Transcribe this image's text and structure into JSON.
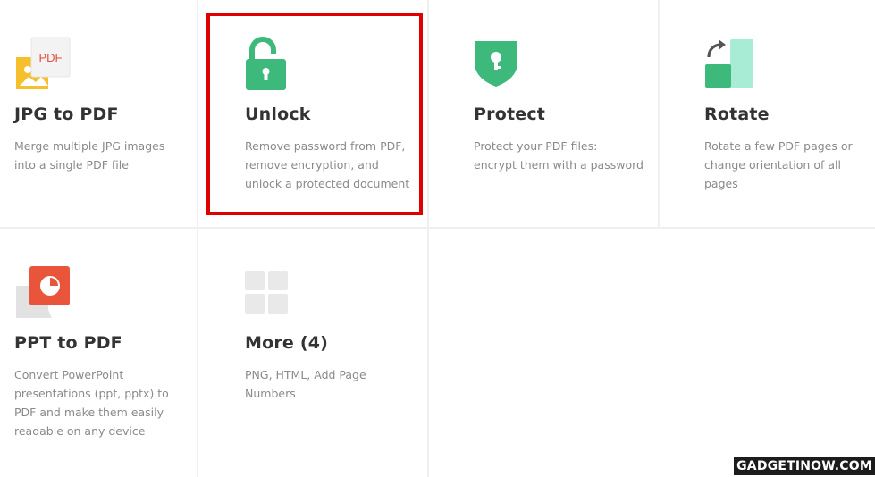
{
  "tools": [
    {
      "title": "JPG to PDF",
      "desc": "Merge multiple JPG images into a single PDF file",
      "icon": "jpg-to-pdf-icon",
      "icon_text": "PDF"
    },
    {
      "title": "Unlock",
      "desc": "Remove password from PDF, remove encryption, and unlock a protected document",
      "icon": "unlocked-padlock-icon",
      "highlighted": true
    },
    {
      "title": "Protect",
      "desc": "Protect your PDF files: encrypt them with a password",
      "icon": "shield-keyhole-icon"
    },
    {
      "title": "Rotate",
      "desc": "Rotate a few PDF pages or change orientation of all pages",
      "icon": "rotate-pages-icon"
    },
    {
      "title": "PPT to PDF",
      "desc": "Convert PowerPoint presentations (ppt, pptx) to PDF and make them easily readable on any device",
      "icon": "ppt-to-pdf-icon"
    },
    {
      "title": "More (4)",
      "desc": "PNG, HTML, Add Page Numbers",
      "icon": "grid-more-icon"
    }
  ],
  "watermark": "GADGETINOW.COM",
  "colors": {
    "green": "#3dba7b",
    "green_dark": "#2f9e67",
    "yellow": "#f6c02c",
    "red_pdf": "#e74c3c",
    "ppt_red": "#e8553a",
    "rotate_light": "#a8ecd6",
    "grey_tile": "#e9e9e9",
    "highlight_red": "#e00000"
  }
}
